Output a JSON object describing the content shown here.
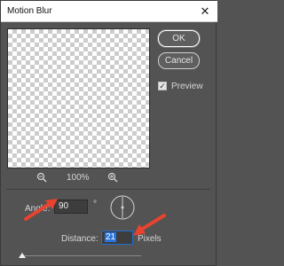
{
  "window": {
    "title": "Motion Blur",
    "close_glyph": "✕"
  },
  "buttons": {
    "ok": "OK",
    "cancel": "Cancel"
  },
  "preview_toggle": {
    "label": "Preview",
    "checked": true,
    "check_glyph": "✓"
  },
  "zoom": {
    "level": "100%",
    "zoom_out_icon": "zoom-out-icon",
    "zoom_in_icon": "zoom-in-icon"
  },
  "angle": {
    "label": "Angle:",
    "value": "90",
    "unit": "°"
  },
  "distance": {
    "label": "Distance:",
    "value": "21",
    "unit": "Pixels"
  },
  "colors": {
    "dialog_bg": "#535353",
    "annotation_arrow": "#e8432f",
    "focus": "#1f6fd0"
  }
}
